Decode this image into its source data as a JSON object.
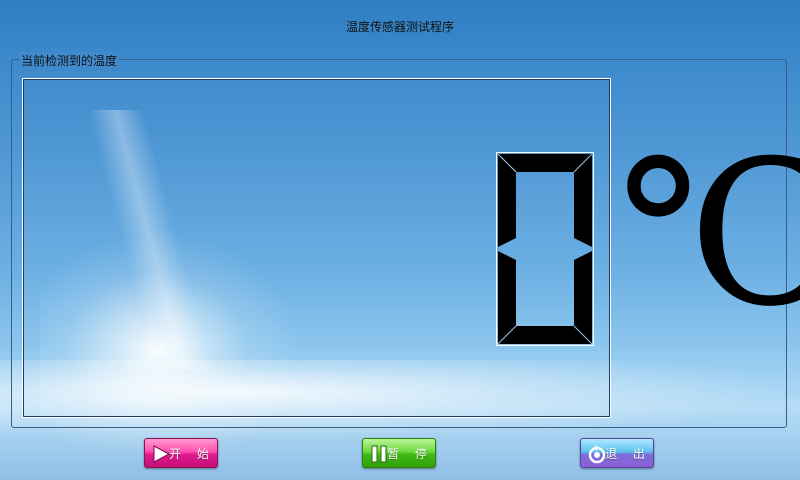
{
  "window": {
    "title": "温度传感器测试程序"
  },
  "groupbox": {
    "title": "当前检测到的温度"
  },
  "reading": {
    "digit_segments": [
      "a",
      "b",
      "c",
      "d",
      "e",
      "f"
    ],
    "digit_value": "0",
    "unit": "℃"
  },
  "buttons": {
    "start": {
      "label": "开 始",
      "icon": "play-icon"
    },
    "pause": {
      "label": "暂 停",
      "icon": "pause-icon"
    },
    "exit": {
      "label": "退 出",
      "icon": "exit-icon"
    }
  },
  "colors": {
    "sky_top": "#2f7fc4",
    "sky_bottom": "#b5dcf6",
    "start_button": "#e01b8e",
    "pause_button": "#3fbb15",
    "exit_button": "#5cc3ee",
    "digit": "#000000"
  }
}
